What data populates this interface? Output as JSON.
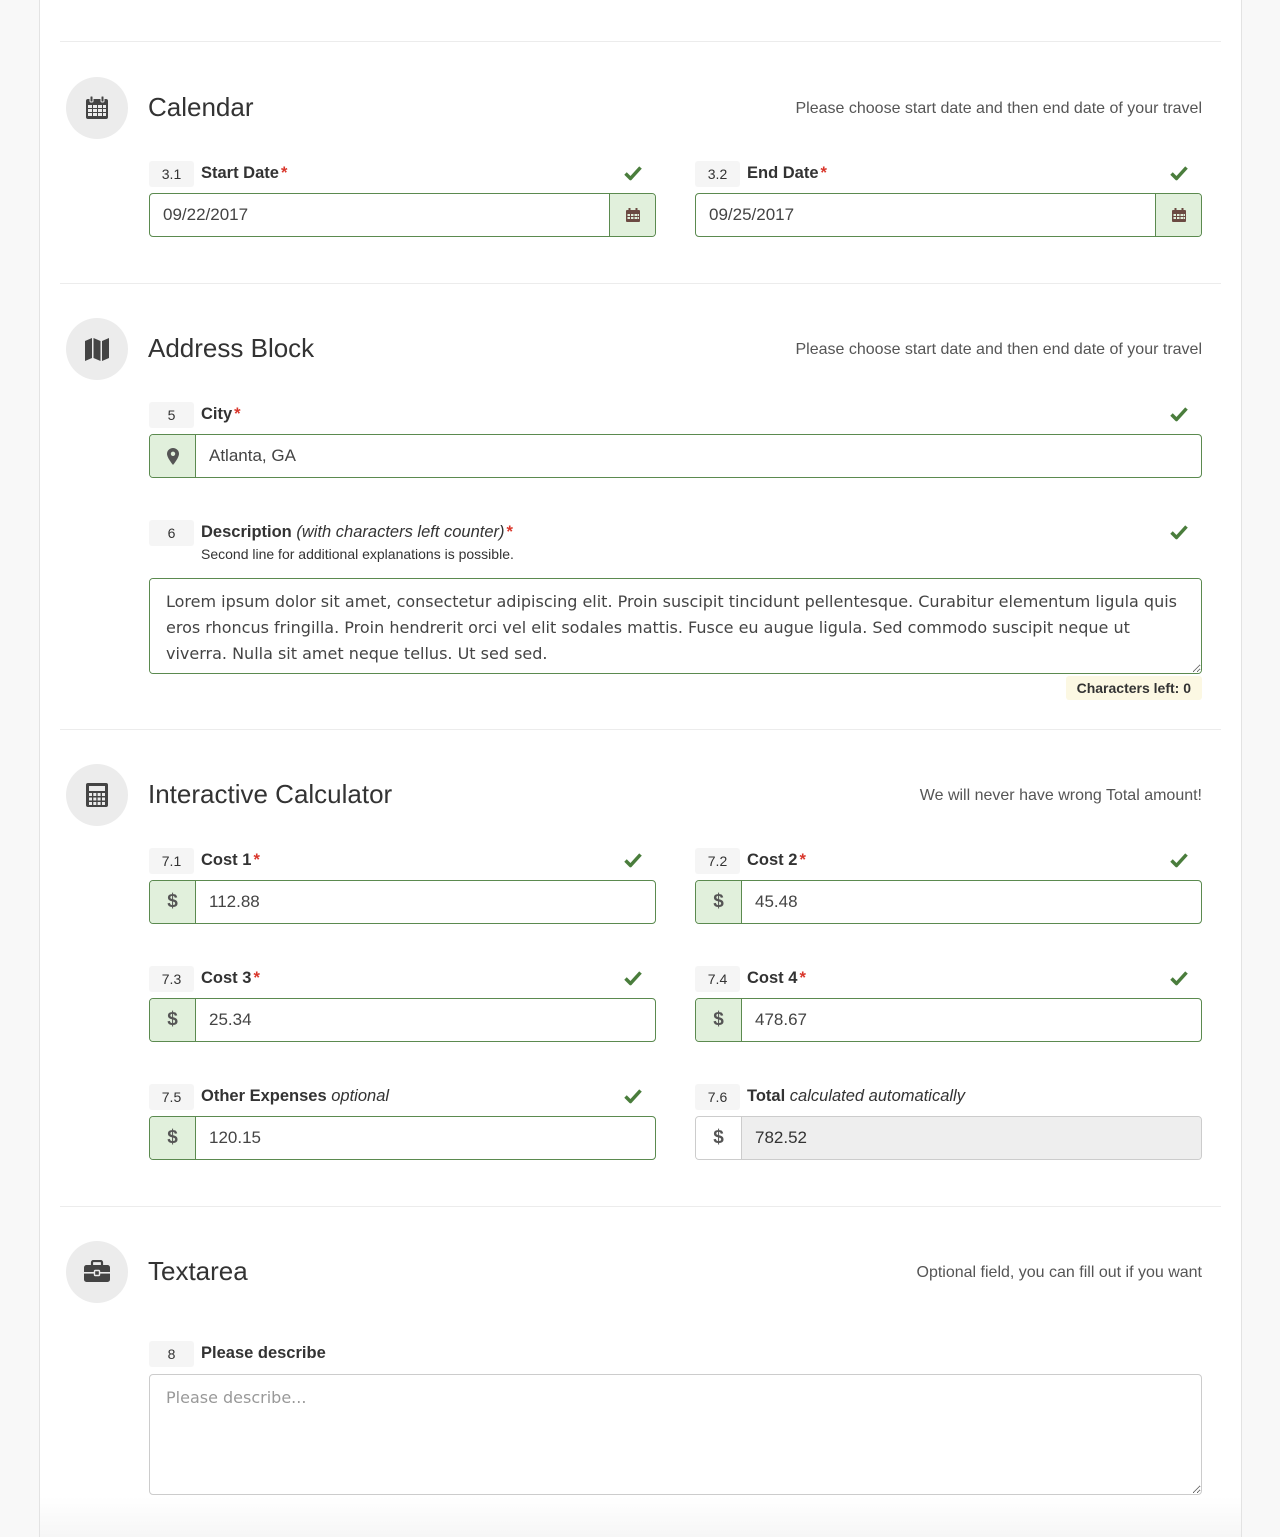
{
  "sections": {
    "calendar": {
      "icon": "calendar-icon",
      "title": "Calendar",
      "hint": "Please choose start date and then end date of your travel",
      "start": {
        "number": "3.1",
        "label": "Start Date",
        "required": "*",
        "value": "09/22/2017",
        "valid": true,
        "addon_icon": "calendar-icon"
      },
      "end": {
        "number": "3.2",
        "label": "End Date",
        "required": "*",
        "value": "09/25/2017",
        "valid": true,
        "addon_icon": "calendar-icon"
      }
    },
    "address": {
      "icon": "map-icon",
      "title": "Address Block",
      "hint": "Please choose start date and then end date of your travel",
      "city": {
        "number": "5",
        "label": "City",
        "required": "*",
        "value": "Atlanta, GA",
        "valid": true,
        "addon_icon": "map-marker-icon"
      },
      "description": {
        "number": "6",
        "label": "Description",
        "label_note": "(with characters left counter)",
        "required": "*",
        "sub_label": "Second line for additional explanations is possible.",
        "value": "Lorem ipsum dolor sit amet, consectetur adipiscing elit. Proin suscipit tincidunt pellentesque. Curabitur elementum ligula quis eros rhoncus fringilla. Proin hendrerit orci vel elit sodales mattis. Fusce eu augue ligula. Sed commodo suscipit neque ut viverra. Nulla sit amet neque tellus. Ut sed sed.",
        "valid": true,
        "counter": "Characters left: 0"
      }
    },
    "calculator": {
      "icon": "calculator-icon",
      "title": "Interactive Calculator",
      "hint": "We will never have wrong Total amount!",
      "currency_symbol": "$",
      "cost1": {
        "number": "7.1",
        "label": "Cost 1",
        "required": "*",
        "value": "112.88",
        "valid": true
      },
      "cost2": {
        "number": "7.2",
        "label": "Cost 2",
        "required": "*",
        "value": "45.48",
        "valid": true
      },
      "cost3": {
        "number": "7.3",
        "label": "Cost 3",
        "required": "*",
        "value": "25.34",
        "valid": true
      },
      "cost4": {
        "number": "7.4",
        "label": "Cost 4",
        "required": "*",
        "value": "478.67",
        "valid": true
      },
      "other": {
        "number": "7.5",
        "label": "Other Expenses",
        "label_note": "optional",
        "value": "120.15",
        "valid": true
      },
      "total": {
        "number": "7.6",
        "label": "Total",
        "label_note": "calculated automatically",
        "value": "782.52",
        "readonly": true
      }
    },
    "textarea": {
      "icon": "briefcase-icon",
      "title": "Textarea",
      "hint": "Optional field, you can fill out if you want",
      "describe": {
        "number": "8",
        "label": "Please describe",
        "value": "",
        "placeholder": "Please describe..."
      }
    }
  },
  "colors": {
    "valid_border": "#5b8a4f",
    "valid_addon_bg": "#e1f0dc",
    "check_green": "#4a7d3c",
    "required_red": "#d9362b",
    "counter_bg": "#fcf8e3"
  }
}
